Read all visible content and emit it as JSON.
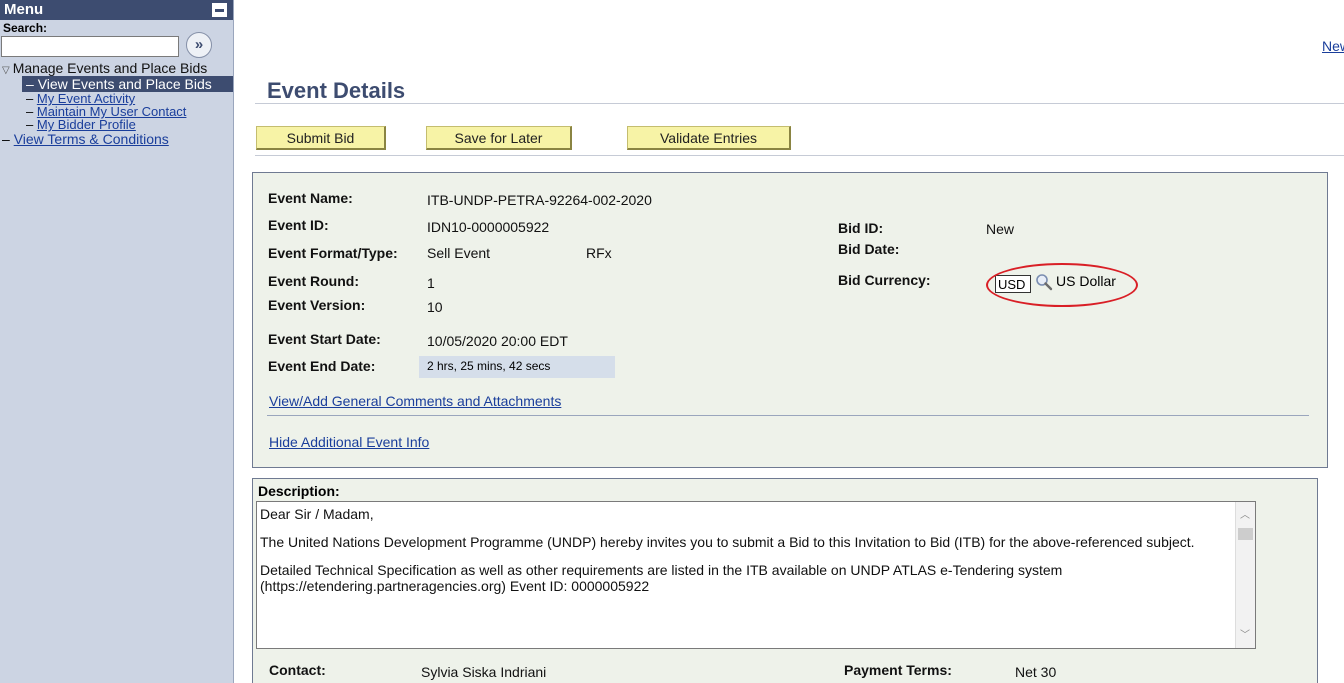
{
  "sidebar": {
    "title": "Menu",
    "search_label": "Search:",
    "search_value": "",
    "go_glyph": "»",
    "root_item": "Manage Events and Place Bids",
    "items": [
      {
        "label": "View Events and Place Bids",
        "selected": true
      },
      {
        "label": "My Event Activity"
      },
      {
        "label": "Maintain My User Contact"
      },
      {
        "label": "My Bidder Profile"
      }
    ],
    "terms_link": "View Terms & Conditions",
    "dash": "–"
  },
  "header": {
    "new_link": "New",
    "title": "Event Details"
  },
  "toolbar": {
    "submit_label": "Submit Bid",
    "save_label": "Save for Later",
    "validate_label": "Validate Entries"
  },
  "event": {
    "name_label": "Event Name:",
    "name": "ITB-UNDP-PETRA-92264-002-2020",
    "id_label": "Event ID:",
    "id": "IDN10-0000005922",
    "format_label": "Event Format/Type:",
    "format": "Sell Event",
    "type": "RFx",
    "round_label": "Event Round:",
    "round": "1",
    "version_label": "Event Version:",
    "version": "10",
    "start_label": "Event Start Date:",
    "start": "10/05/2020 20:00 EDT",
    "end_label": "Event End Date:",
    "end": "2 hrs,  25 mins,  42 secs",
    "bid_id_label": "Bid ID:",
    "bid_id": "New",
    "bid_date_label": "Bid Date:",
    "bid_date": "",
    "currency_label": "Bid Currency:",
    "currency_code": "USD",
    "currency_name": "US Dollar",
    "comments_link": "View/Add General Comments and Attachments",
    "hide_info_link": "Hide Additional Event Info",
    "highlight_color": "#d91f26"
  },
  "description": {
    "label": "Description:",
    "paragraphs": [
      "Dear Sir / Madam,",
      "The United Nations Development Programme (UNDP) hereby invites you to submit a Bid to this Invitation to Bid (ITB) for the above-referenced subject.",
      "Detailed Technical Specification as well as other requirements are listed in the ITB available on UNDP ATLAS e-Tendering system (https://etendering.partneragencies.org) Event ID: 0000005922"
    ]
  },
  "contact": {
    "contact_label": "Contact:",
    "contact": "Sylvia Siska Indriani",
    "payment_label": "Payment Terms:",
    "payment": "Net 30"
  },
  "colors": {
    "menu_header": "#3d4c70",
    "sidebar_bg": "#ccd4e3",
    "button_bg": "#f7f3a6",
    "panel_bg": "#eef2ea",
    "link": "#1a3e9b"
  }
}
